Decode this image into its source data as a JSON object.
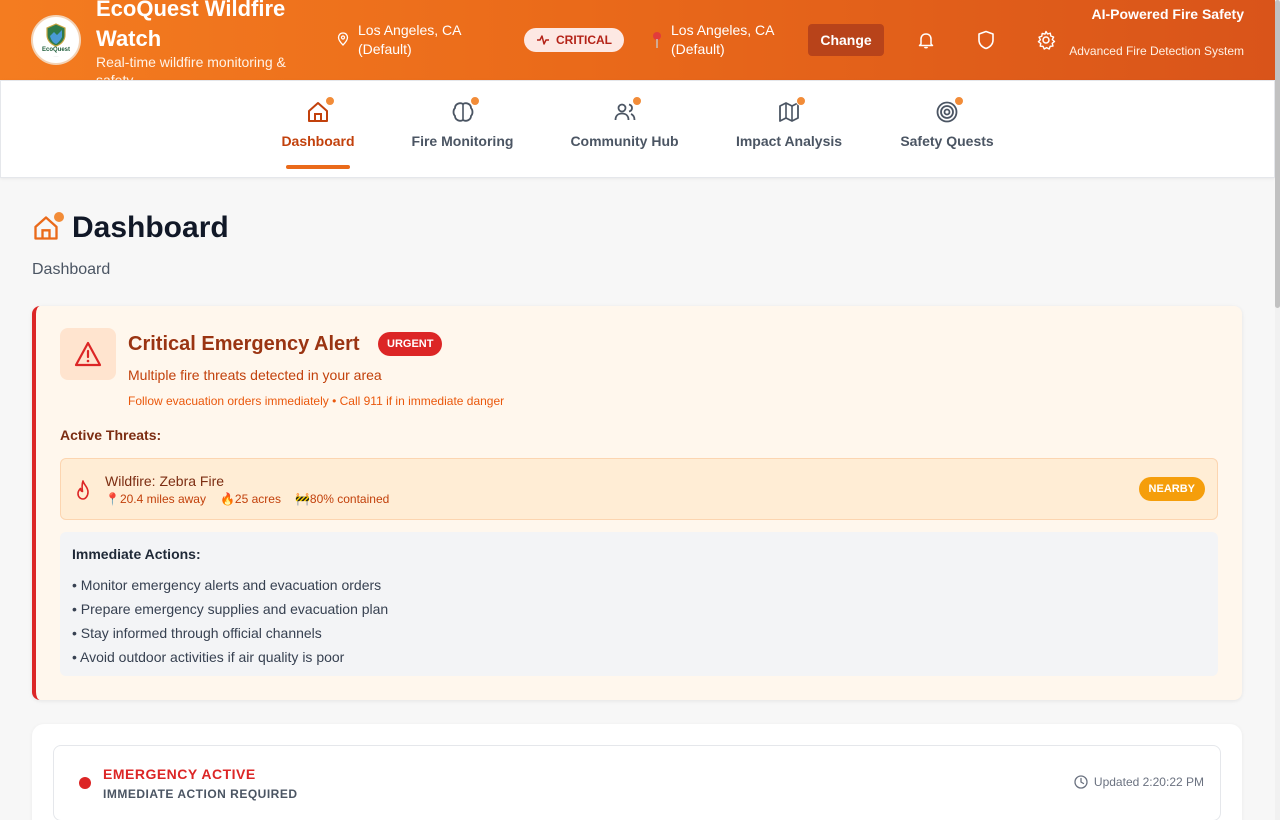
{
  "header": {
    "logo_text": "EcoQuest",
    "title": "EcoQuest Wildfire Watch",
    "subtitle": "Real-time wildfire monitoring & safety",
    "location_primary": "Los Angeles, CA (Default)",
    "status_badge": "CRITICAL",
    "location_secondary": "Los Angeles, CA (Default)",
    "change_label": "Change",
    "ai_title": "AI-Powered Fire Safety",
    "ai_subtitle": "Advanced Fire Detection System",
    "colors": {
      "gradient_start": "#f47c20",
      "gradient_end": "#d9541a"
    }
  },
  "nav": {
    "tabs": [
      {
        "label": "Dashboard",
        "icon": "home-icon",
        "active": true
      },
      {
        "label": "Fire Monitoring",
        "icon": "brain-icon",
        "active": false
      },
      {
        "label": "Community Hub",
        "icon": "users-icon",
        "active": false
      },
      {
        "label": "Impact Analysis",
        "icon": "map-icon",
        "active": false
      },
      {
        "label": "Safety Quests",
        "icon": "target-icon",
        "active": false
      }
    ]
  },
  "page": {
    "title": "Dashboard",
    "breadcrumb": "Dashboard"
  },
  "alert": {
    "title": "Critical Emergency Alert",
    "badge": "URGENT",
    "subtitle": "Multiple fire threats detected in your area",
    "note": "Follow evacuation orders immediately • Call 911 if in immediate danger",
    "threats_label": "Active Threats:",
    "threat": {
      "name": "Wildfire: Zebra Fire",
      "distance": "📍20.4 miles away",
      "acres": "🔥25 acres",
      "contained": "🚧80% contained",
      "badge": "NEARBY"
    },
    "actions_title": "Immediate Actions:",
    "actions": [
      "• Monitor emergency alerts and evacuation orders",
      "• Prepare emergency supplies and evacuation plan",
      "• Stay informed through official channels",
      "• Avoid outdoor activities if air quality is poor"
    ]
  },
  "emergency": {
    "title": "EMERGENCY ACTIVE",
    "subtitle": "IMMEDIATE ACTION REQUIRED",
    "updated": "Updated 2:20:22 PM"
  }
}
